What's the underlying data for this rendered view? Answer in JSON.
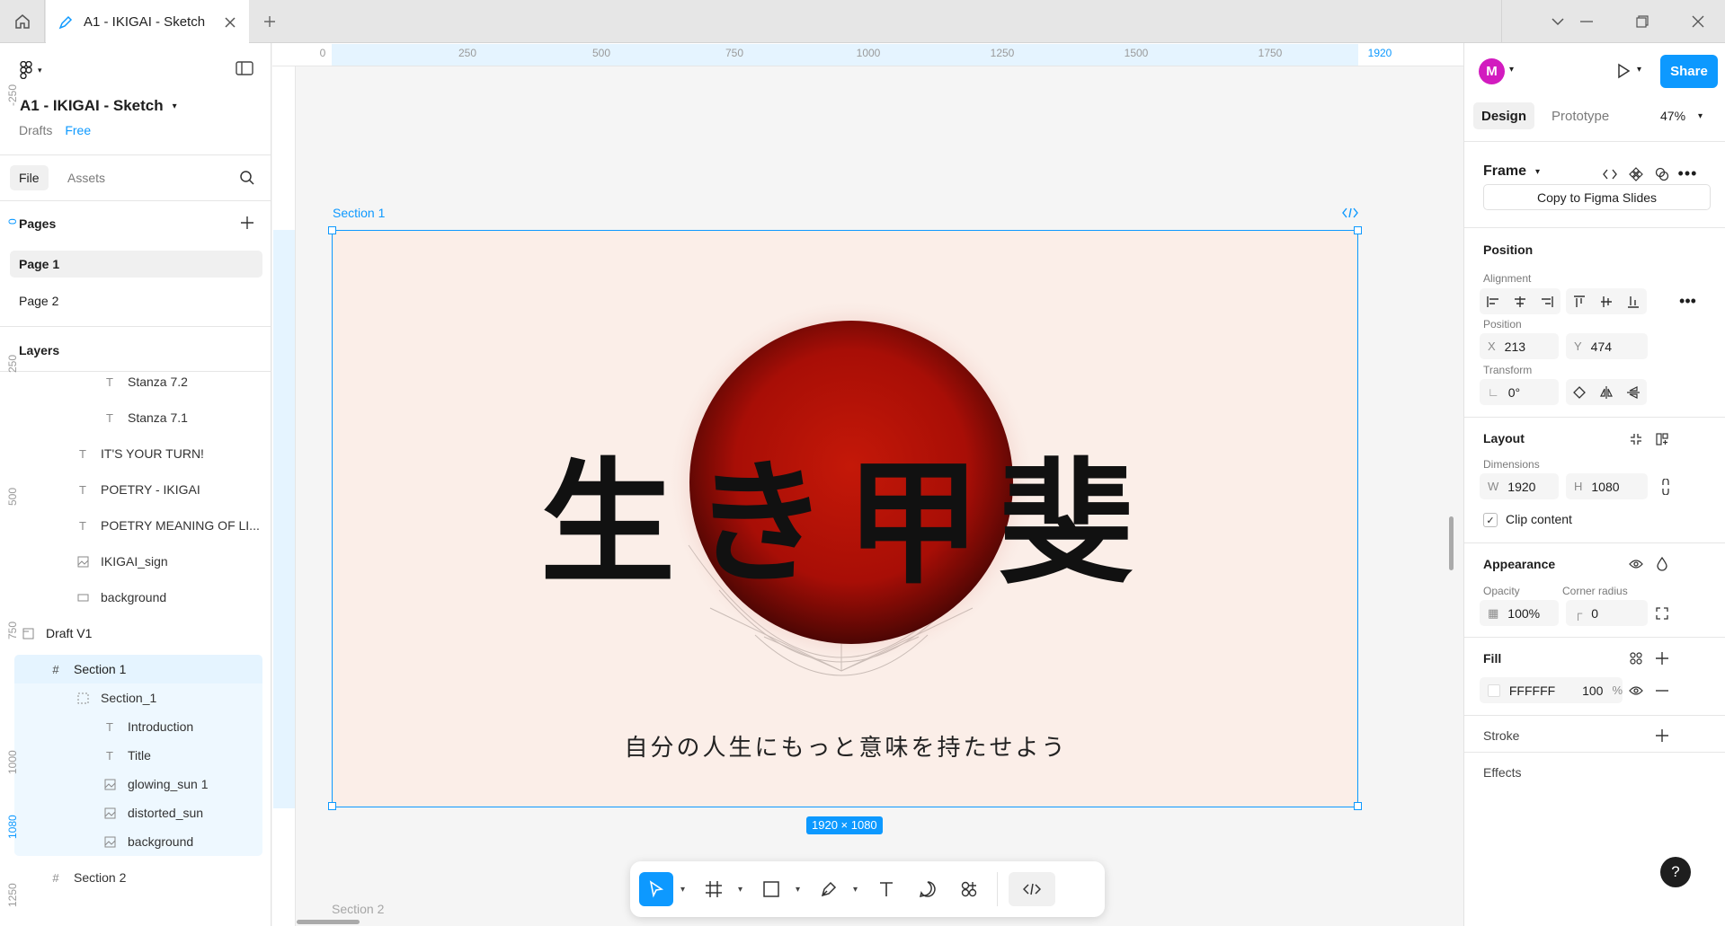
{
  "browser": {
    "tab_title": "A1 - IKIGAI - Sketch",
    "new_tab": "+"
  },
  "left_panel": {
    "file_title": "A1 - IKIGAI - Sketch",
    "drafts": "Drafts",
    "plan": "Free",
    "tabs": [
      "File",
      "Assets"
    ],
    "pages_label": "Pages",
    "pages": [
      "Page 1",
      "Page 2"
    ],
    "layers_label": "Layers",
    "layers": [
      {
        "label": "Stanza 7.2",
        "icon": "T"
      },
      {
        "label": "Stanza 7.1",
        "icon": "T"
      },
      {
        "label": "IT'S YOUR TURN!",
        "icon": "T"
      },
      {
        "label": "POETRY - IKIGAI",
        "icon": "T"
      },
      {
        "label": "POETRY MEANING OF LI...",
        "icon": "T"
      },
      {
        "label": "IKIGAI_sign",
        "icon": "image"
      },
      {
        "label": "background",
        "icon": "rect"
      },
      {
        "label": "Draft V1",
        "icon": "section"
      },
      {
        "label": "Section 1",
        "icon": "frame"
      },
      {
        "label": "Section_1",
        "icon": "dashed"
      },
      {
        "label": "Introduction",
        "icon": "T"
      },
      {
        "label": "Title",
        "icon": "T"
      },
      {
        "label": "glowing_sun 1",
        "icon": "image"
      },
      {
        "label": "distorted_sun",
        "icon": "image"
      },
      {
        "label": "background",
        "icon": "image"
      },
      {
        "label": "Section 2",
        "icon": "frame"
      }
    ]
  },
  "rulers": {
    "top": [
      "0",
      "250",
      "500",
      "750",
      "1000",
      "1250",
      "1500",
      "1750",
      "1920"
    ],
    "left": [
      "-250",
      "0",
      "250",
      "500",
      "750",
      "1000",
      "1080",
      "1250"
    ]
  },
  "canvas": {
    "section_label": "Section 1",
    "frame_title": "生き甲斐",
    "frame_subtitle": "自分の人生にもっと意味を持たせよう",
    "dimensions": "1920 × 1080",
    "next_section": "Section 2"
  },
  "right_panel": {
    "avatar_initial": "M",
    "share": "Share",
    "tabs": [
      "Design",
      "Prototype"
    ],
    "zoom": "47%",
    "frame_type": "Frame",
    "copy_button": "Copy to Figma Slides",
    "position_title": "Position",
    "alignment_label": "Alignment",
    "position_label": "Position",
    "x_label": "X",
    "x_value": "213",
    "y_label": "Y",
    "y_value": "474",
    "transform_label": "Transform",
    "rotation": "0°",
    "layout_title": "Layout",
    "dimensions_label": "Dimensions",
    "w_label": "W",
    "w_value": "1920",
    "h_label": "H",
    "h_value": "1080",
    "clip_content": "Clip content",
    "appearance_title": "Appearance",
    "opacity_label": "Opacity",
    "opacity_value": "100%",
    "corner_label": "Corner radius",
    "corner_value": "0",
    "fill_title": "Fill",
    "fill_hex": "FFFFFF",
    "fill_opacity": "100",
    "fill_pct": "%",
    "stroke_title": "Stroke",
    "effects_title": "Effects",
    "help": "?"
  },
  "colors": {
    "accent": "#0d99ff",
    "avatar": "#d21bbf",
    "sun": "#b01208",
    "frame_bg": "#fbeee8"
  }
}
